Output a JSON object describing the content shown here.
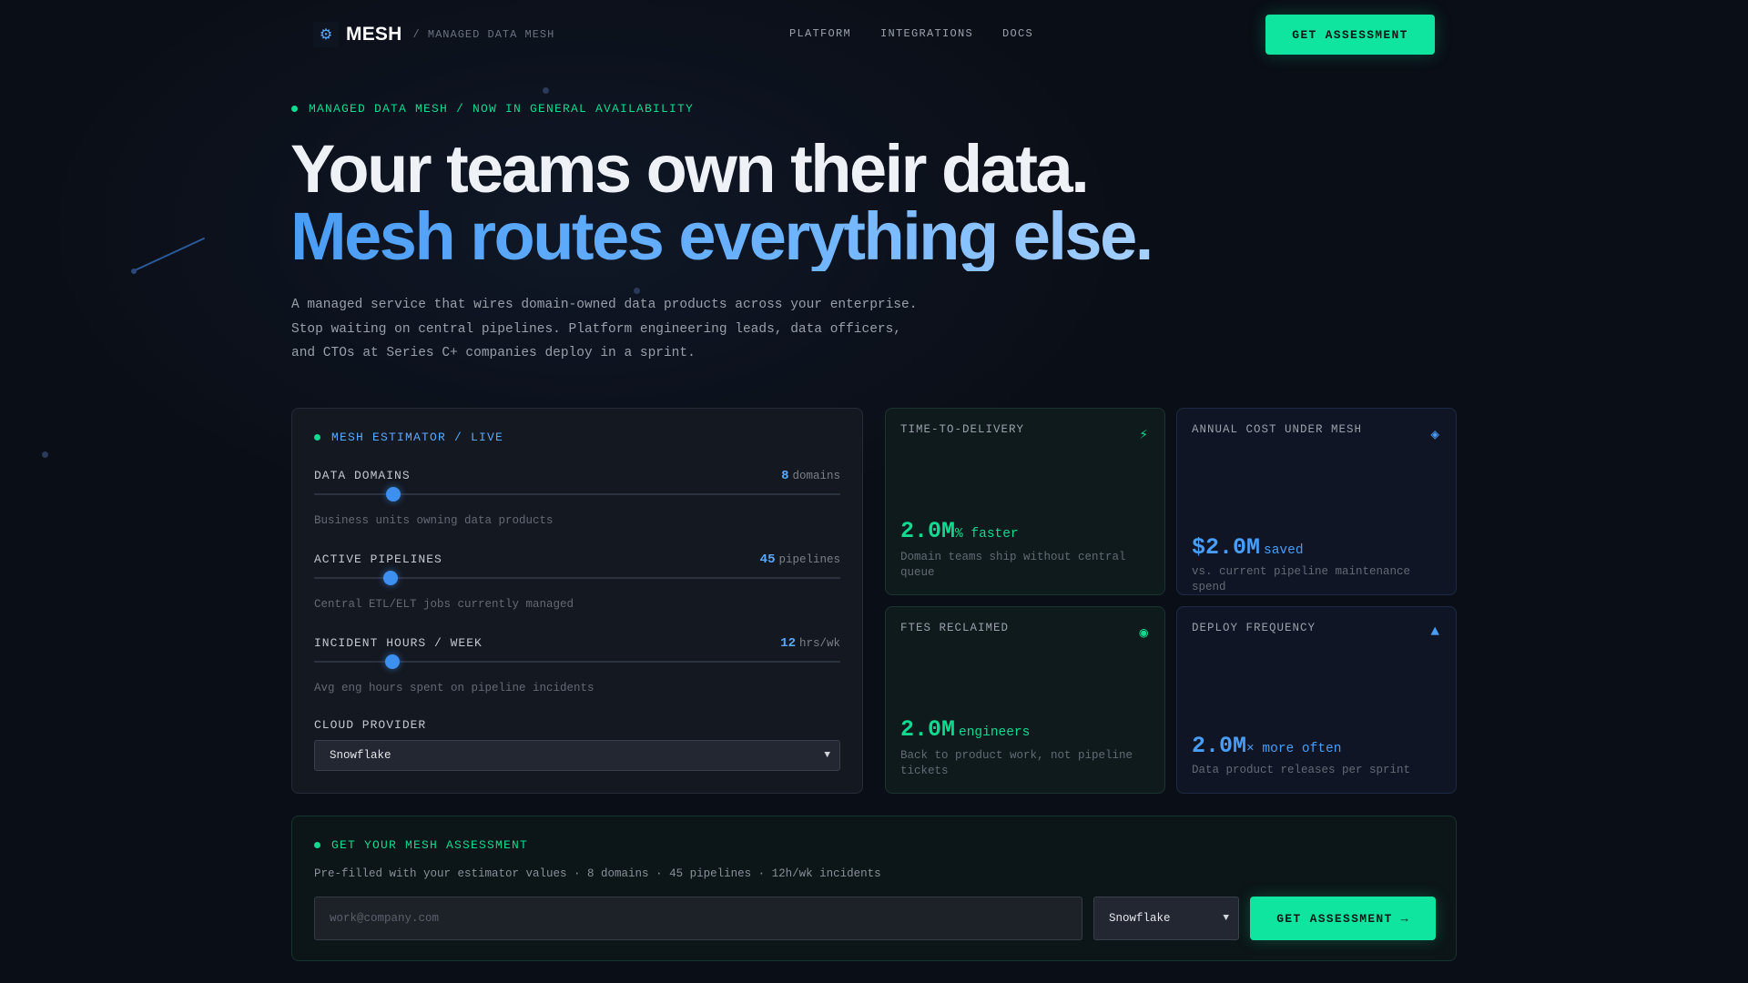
{
  "nav": {
    "logo_icon": "gear-icon",
    "logo_glyph": "⚙",
    "brand": "MESH",
    "tagline": "/ MANAGED DATA MESH",
    "links": [
      "PLATFORM",
      "INTEGRATIONS",
      "DOCS"
    ],
    "cta": "GET ASSESSMENT"
  },
  "hero": {
    "eyebrow": "MANAGED DATA MESH / NOW IN GENERAL AVAILABILITY",
    "headline_1": "Your teams own their data.",
    "headline_2": "Mesh routes everything else.",
    "lead": [
      "A managed service that wires domain-owned data products across your enterprise.",
      "Stop waiting on central pipelines. Platform engineering leads, data officers,",
      "and CTOs at Series C+ companies deploy in a sprint."
    ]
  },
  "estimator": {
    "title": "MESH ESTIMATOR / LIVE",
    "sliders": [
      {
        "label": "DATA DOMAINS",
        "value": "8",
        "unit": "domains",
        "help": "Business units owning data products",
        "level": 0.15
      },
      {
        "label": "ACTIVE PIPELINES",
        "value": "45",
        "unit": "pipelines",
        "help": "Central ETL/ELT jobs currently managed",
        "level": 0.145
      },
      {
        "label": "INCIDENT HOURS / WEEK",
        "value": "12",
        "unit": "hrs/wk",
        "help": "Avg eng hours spent on pipeline incidents",
        "level": 0.148
      }
    ],
    "cloud_label": "CLOUD PROVIDER",
    "cloud_value": "Snowflake"
  },
  "cards": [
    {
      "title": "TIME-TO-DELIVERY",
      "icon": "lightning-icon",
      "glyph": "⚡",
      "value": "2.0M",
      "suffix": "% faster",
      "desc": "Domain teams ship without central queue",
      "tone": "green"
    },
    {
      "title": "ANNUAL COST UNDER MESH",
      "icon": "diamond-icon",
      "glyph": "◈",
      "value": "$2.0M",
      "suffix": "saved",
      "desc": "vs. current pipeline maintenance spend",
      "tone": "blue"
    },
    {
      "title": "FTES RECLAIMED",
      "icon": "target-icon",
      "glyph": "◉",
      "value": "2.0M",
      "suffix": "engineers",
      "desc": "Back to product work, not pipeline tickets",
      "tone": "green"
    },
    {
      "title": "DEPLOY FREQUENCY",
      "icon": "triangle-up-icon",
      "glyph": "▲",
      "value": "2.0M",
      "suffix": "× more often",
      "desc": "Data product releases per sprint",
      "tone": "blue"
    }
  ],
  "assessment": {
    "title": "GET YOUR MESH ASSESSMENT",
    "subtitle": "Pre-filled with your estimator values · 8 domains · 45 pipelines · 12h/wk incidents",
    "email_placeholder": "work@company.com",
    "provider": "Snowflake",
    "cta": "GET ASSESSMENT →"
  },
  "colors": {
    "accent_green": "#10e5a0",
    "accent_blue": "#4a9df5",
    "background": "#0a0e16"
  }
}
